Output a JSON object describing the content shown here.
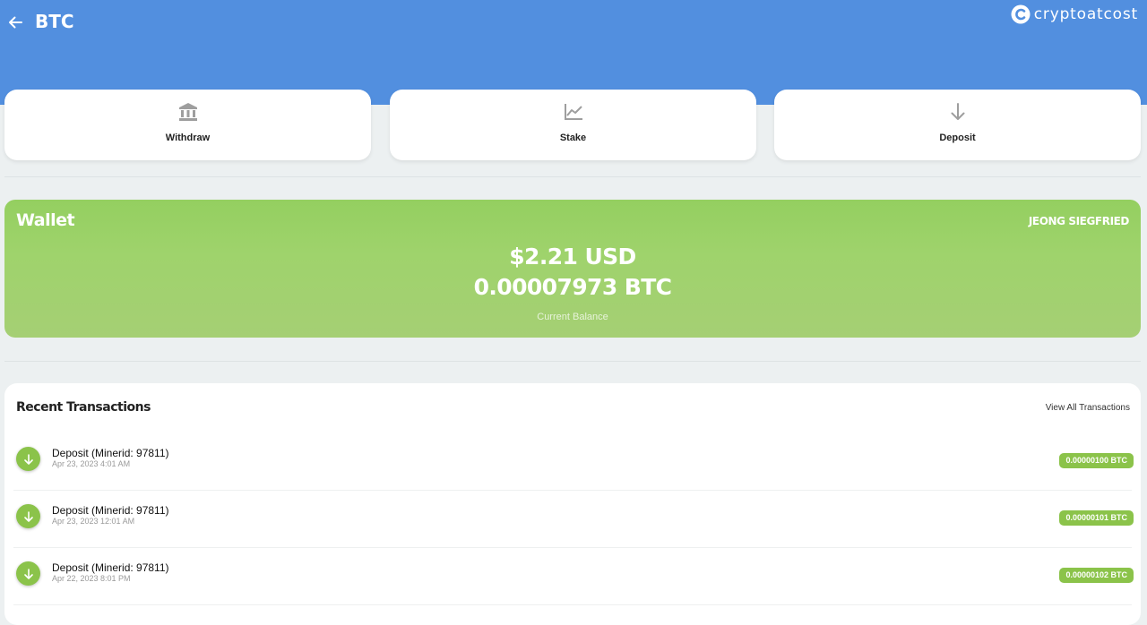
{
  "header": {
    "title": "BTC",
    "brand": "cryptoatcost",
    "back_icon": "arrow-left-icon",
    "color": "#528fdf"
  },
  "actions": [
    {
      "label": "Withdraw",
      "icon": "bank-icon"
    },
    {
      "label": "Stake",
      "icon": "chart-line-icon"
    },
    {
      "label": "Deposit",
      "icon": "arrow-down-icon"
    }
  ],
  "wallet": {
    "title": "Wallet",
    "owner": "JEONG SIEGFRIED",
    "usd": "$2.21 USD",
    "btc": "0.00007973 BTC",
    "subtitle": "Current Balance",
    "color": "#9fd36c"
  },
  "transactions": {
    "heading": "Recent Transactions",
    "view_all": "View All Transactions",
    "accent": "#8bc34a",
    "items": [
      {
        "title": "Deposit (Minerid: 97811)",
        "date": "Apr 23, 2023 4:01 AM",
        "amount": "0.00000100 BTC"
      },
      {
        "title": "Deposit (Minerid: 97811)",
        "date": "Apr 23, 2023 12:01 AM",
        "amount": "0.00000101 BTC"
      },
      {
        "title": "Deposit (Minerid: 97811)",
        "date": "Apr 22, 2023 8:01 PM",
        "amount": "0.00000102 BTC"
      }
    ]
  }
}
